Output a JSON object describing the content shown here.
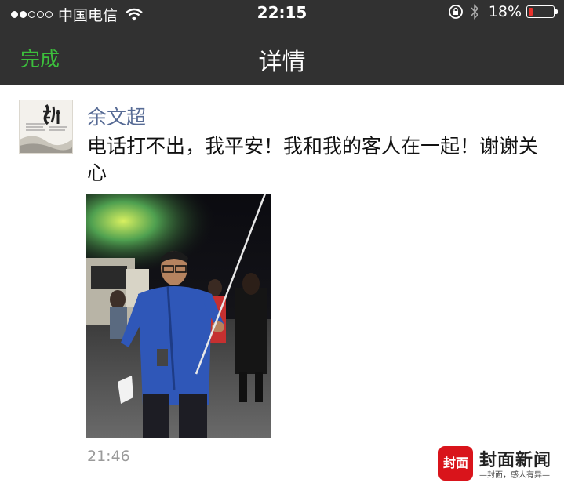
{
  "status_bar": {
    "signal_dots_filled": 2,
    "signal_dots_total": 5,
    "carrier": "中国电信",
    "time": "22:15",
    "battery_percent": "18%",
    "battery_level": 0.18,
    "icons": [
      "wifi-icon",
      "rotation-lock-icon",
      "bluetooth-icon",
      "battery-icon"
    ]
  },
  "nav": {
    "done_label": "完成",
    "title": "详情"
  },
  "post": {
    "author": "余文超",
    "text": "电话打不出，我平安！我和我的客人在一起！谢谢关心",
    "time": "21:46",
    "avatar_text": "旅行"
  },
  "watermark": {
    "badge": "封面",
    "title": "封面新闻",
    "subtitle": "—封面，感人有异—"
  },
  "colors": {
    "bar_bg": "#313131",
    "accent_green": "#3cbf3c",
    "author_blue": "#576b95",
    "battery_red": "#e8322c"
  }
}
